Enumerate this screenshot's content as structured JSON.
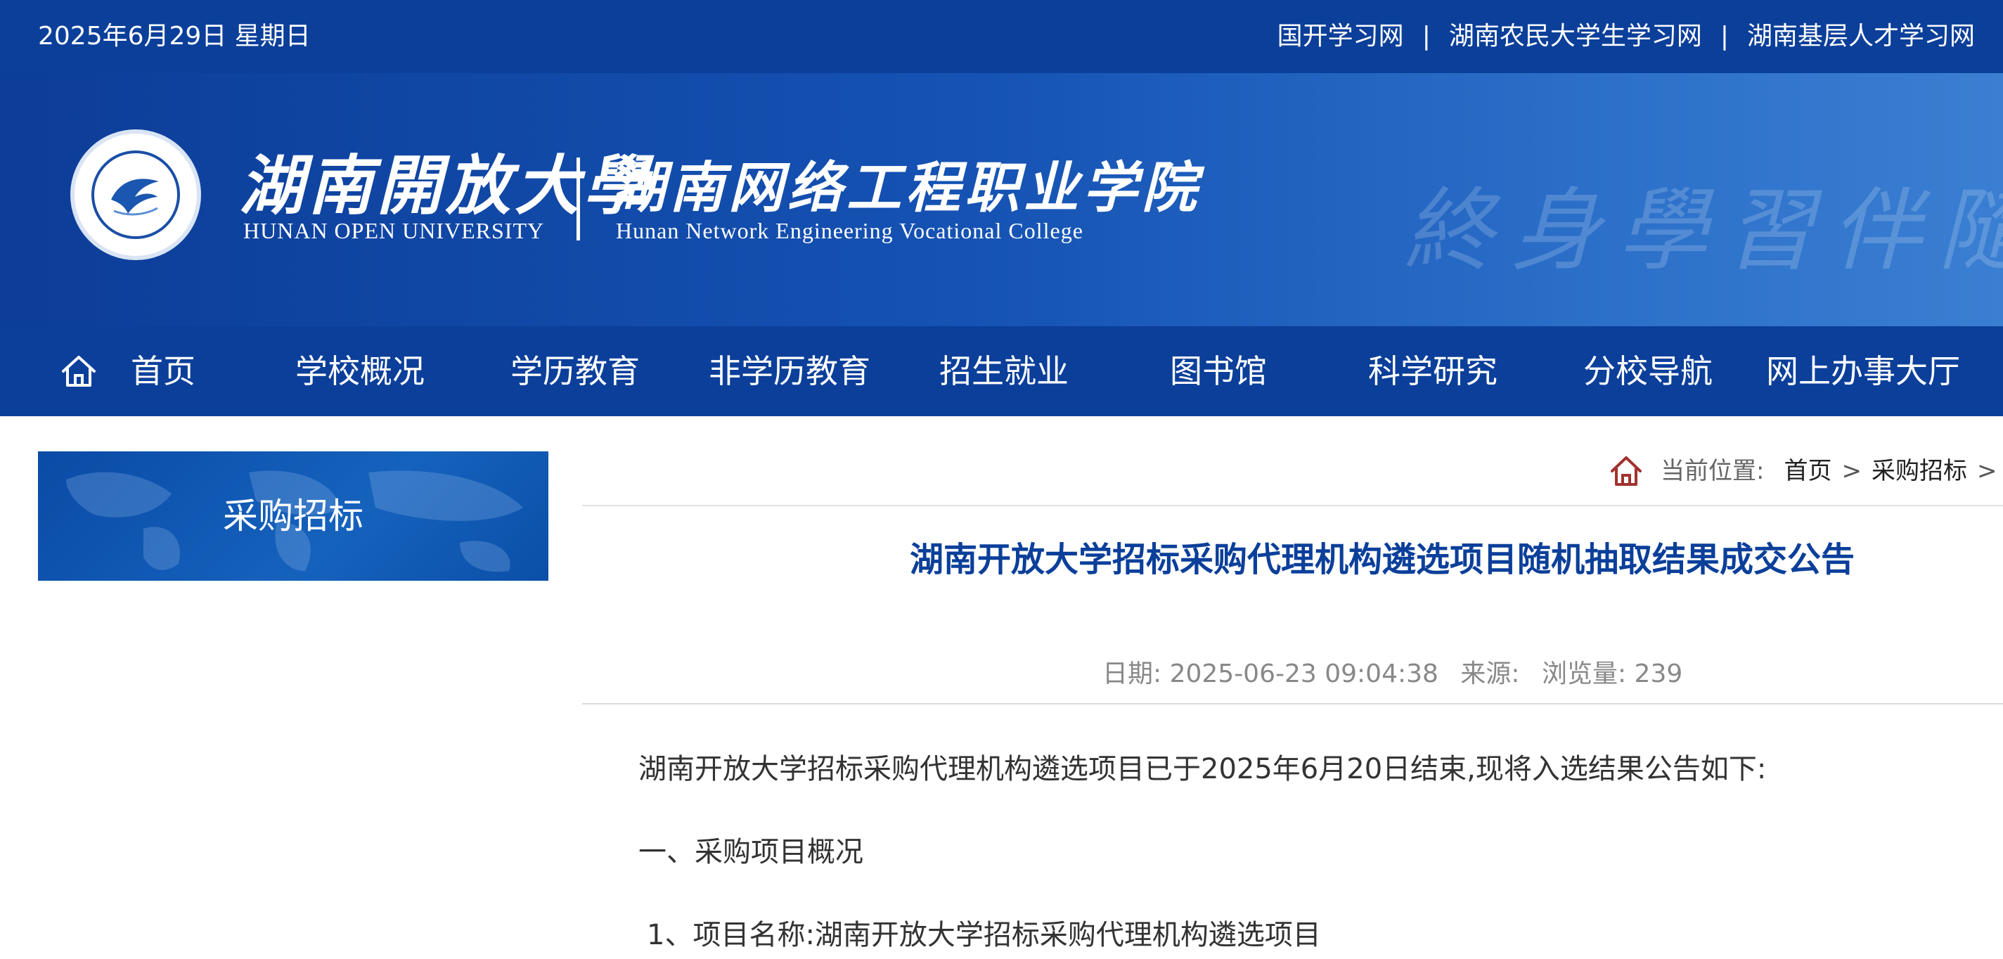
{
  "topbar": {
    "date": "2025年6月29日 星期日",
    "links": [
      {
        "label": "国开学习网"
      },
      {
        "label": "湖南农民大学生学习网"
      },
      {
        "label": "湖南基层人才学习网"
      }
    ],
    "separator": "|"
  },
  "banner": {
    "university_cn": "湖南開放大學",
    "university_en": "HUNAN OPEN UNIVERSITY",
    "college_cn": "湖南网络工程职业学院",
    "college_en": "Hunan Network Engineering Vocational College",
    "watermark": "終身學習伴隨"
  },
  "nav": {
    "home_icon": "home-icon",
    "items": [
      {
        "label": "首页"
      },
      {
        "label": "学校概况"
      },
      {
        "label": "学历教育"
      },
      {
        "label": "非学历教育"
      },
      {
        "label": "招生就业"
      },
      {
        "label": "图书馆"
      },
      {
        "label": "科学研究"
      },
      {
        "label": "分校导航"
      },
      {
        "label": "网上办事大厅"
      }
    ]
  },
  "sidebar": {
    "title": "采购招标"
  },
  "breadcrumb": {
    "label": "当前位置:",
    "items": [
      {
        "label": "首页"
      },
      {
        "label": "采购招标"
      }
    ],
    "separator": ">"
  },
  "article": {
    "title": "湖南开放大学招标采购代理机构遴选项目随机抽取结果成交公告",
    "meta": {
      "date": "日期: 2025-06-23 09:04:38",
      "source": "来源:",
      "views": "浏览量: 239"
    },
    "paragraphs": [
      "湖南开放大学招标采购代理机构遴选项目已于2025年6月20日结束,现将入选结果公告如下:",
      "一、采购项目概况",
      "1、项目名称:湖南开放大学招标采购代理机构遴选项目"
    ]
  },
  "colors": {
    "primary": "#0b3f9a",
    "title": "#0b3f9a",
    "home_icon_breadcrumb": "#a0322f"
  }
}
